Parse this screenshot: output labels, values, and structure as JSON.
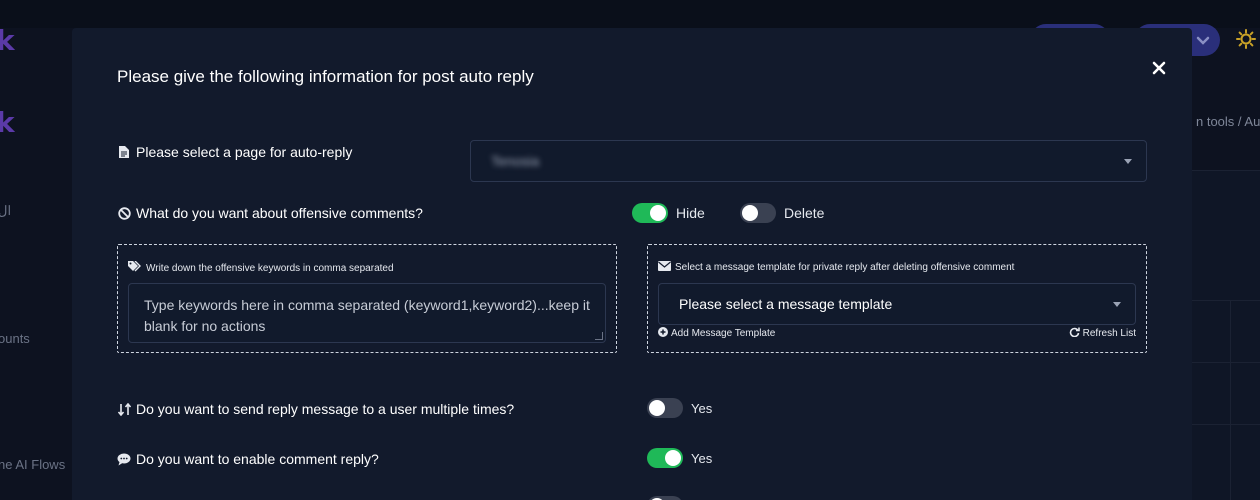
{
  "background": {
    "logo_top": "k",
    "logo_mid": "k",
    "sidebar_texts": [
      "ال",
      "ounts",
      "ne AI Flows"
    ],
    "breadcrumb": "n tools  /  Aut"
  },
  "modal": {
    "title": "Please give the following information for post auto reply",
    "close_icon": "×",
    "page_select": {
      "label": "Please select a page for auto-reply",
      "value": "Tenosia"
    },
    "offensive": {
      "question": "What do you want about offensive comments?",
      "hide_label": "Hide",
      "hide_on": true,
      "delete_label": "Delete",
      "delete_on": false
    },
    "keywords": {
      "label": "Write down the offensive keywords in comma separated",
      "placeholder": "Type keywords here in comma separated (keyword1,keyword2)...keep it blank for no actions"
    },
    "template": {
      "label": "Select a message template for private reply after deleting offensive comment",
      "value": "Please select a message template",
      "add_link": "Add Message Template",
      "refresh_link": "Refresh List"
    },
    "multiple_times": {
      "question": "Do you want to send reply message to a user multiple times?",
      "label": "Yes",
      "on": false
    },
    "comment_reply": {
      "question": "Do you want to enable comment reply?",
      "label": "Yes",
      "on": true
    }
  },
  "colors": {
    "toggle_on": "#1fb958",
    "toggle_off": "#3a4152",
    "modal_bg": "#121a2c",
    "page_bg": "#0d1220"
  },
  "icons": {
    "page_select": "file-icon",
    "offensive": "ban-icon",
    "keywords": "tags-icon",
    "template": "envelope-icon",
    "add_template": "plus-circle-icon",
    "refresh": "refresh-icon",
    "multiple": "sort-icon",
    "comment": "comment-icon",
    "close": "close-icon",
    "theme": "sun-icon"
  }
}
